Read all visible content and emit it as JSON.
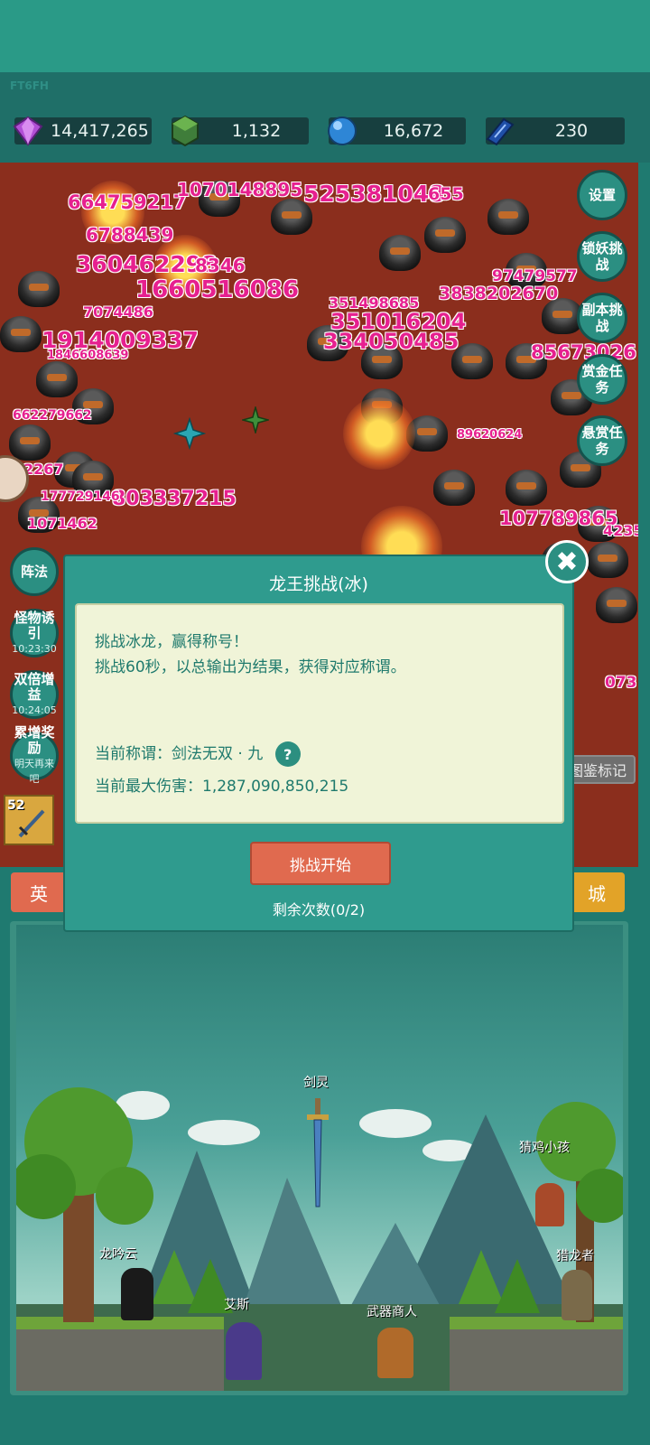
{
  "header": {
    "code": "FT6FH"
  },
  "resources": [
    {
      "icon": "purple-gem-icon",
      "value": "14,417,265"
    },
    {
      "icon": "green-gem-icon",
      "value": "1,132"
    },
    {
      "icon": "blue-orb-icon",
      "value": "16,672"
    },
    {
      "icon": "book-icon",
      "value": "230"
    }
  ],
  "right_menu": [
    {
      "label": "设置"
    },
    {
      "label": "锁妖挑战"
    },
    {
      "label": "副本挑战"
    },
    {
      "label": "赏金任务"
    },
    {
      "label": "悬赏任务"
    }
  ],
  "left_menu": [
    {
      "label": "阵法",
      "timer": ""
    },
    {
      "label": "怪物诱引",
      "timer": "10:23:30"
    },
    {
      "label": "双倍增益",
      "timer": "10:24:05"
    },
    {
      "label": "累增奖励",
      "timer": "明天再来吧"
    }
  ],
  "damage_numbers": [
    "664759217",
    "6788439",
    "360462298",
    "1660516086",
    "1914009337",
    "1070148895",
    "525381048",
    "351016204",
    "334050485",
    "3838202670",
    "97479577",
    "85673026",
    "803337215",
    "107789865",
    "1071462",
    "177729146",
    "89620624",
    "8346",
    "351498685",
    "7074486",
    "1846608639",
    "662279662",
    "655",
    "2267",
    "073",
    "42351"
  ],
  "side_tag": "图鉴标记",
  "skill_slot": {
    "level": "52"
  },
  "bottom_tabs": {
    "left": "英",
    "right": "城"
  },
  "modal": {
    "title": "龙王挑战(冰)",
    "desc_line1": "挑战冰龙，赢得称号！",
    "desc_line2": "挑战60秒，以总输出为结果，获得对应称谓。",
    "title_label": "当前称谓：剑法无双 · 九",
    "help_symbol": "?",
    "damage_label": "当前最大伤害：1,287,090,850,215",
    "start_button": "挑战开始",
    "remaining": "剩余次数(0/2)",
    "close_symbol": "✖"
  },
  "scene": {
    "characters": [
      "剑灵",
      "猜鸡小孩",
      "龙吟云",
      "猎龙者",
      "艾斯",
      "武器商人"
    ]
  },
  "colors": {
    "header": "#2a9a87",
    "battlefield": "#8b2e1d",
    "damage_text": "#e6208f",
    "modal_bg": "#2f9b8e",
    "panel_bg": "#f0f4d8",
    "start_button": "#e06a4f"
  }
}
